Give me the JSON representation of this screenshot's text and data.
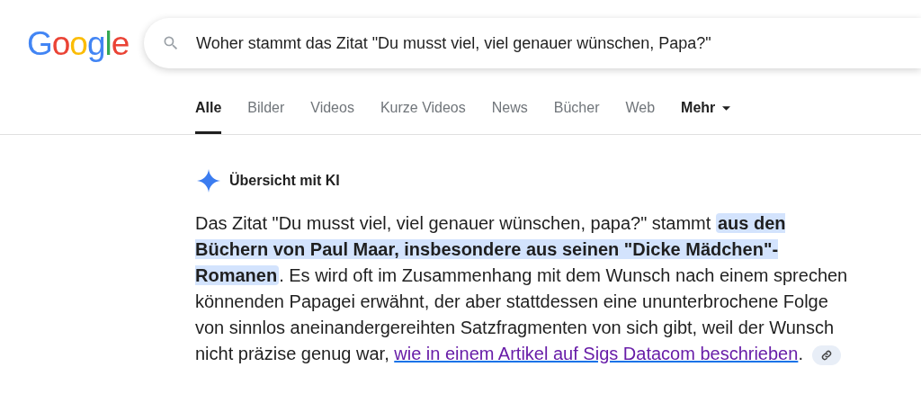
{
  "logo": "Google",
  "search": {
    "value": "Woher stammt das Zitat \"Du musst viel, viel genauer wünschen, Papa?\""
  },
  "tabs": [
    {
      "label": "Alle",
      "selected": true,
      "kind": "tab"
    },
    {
      "label": "Bilder",
      "selected": false,
      "kind": "tab"
    },
    {
      "label": "Videos",
      "selected": false,
      "kind": "tab"
    },
    {
      "label": "Kurze Videos",
      "selected": false,
      "kind": "tab"
    },
    {
      "label": "News",
      "selected": false,
      "kind": "tab"
    },
    {
      "label": "Bücher",
      "selected": false,
      "kind": "tab"
    },
    {
      "label": "Web",
      "selected": false,
      "kind": "tab"
    },
    {
      "label": "Mehr",
      "selected": false,
      "kind": "menu"
    }
  ],
  "ai_overview": {
    "title": "Übersicht mit KI",
    "paragraph": [
      {
        "kind": "text",
        "text": "Das Zitat \"Du musst viel, viel genauer wünschen, papa?\" stammt "
      },
      {
        "kind": "highlight",
        "text": "aus den Büchern von Paul Maar, insbesondere aus seinen \"Dicke Mädchen\"-Romanen"
      },
      {
        "kind": "text",
        "text": ". Es wird oft im Zusammenhang mit dem Wunsch nach einem sprechen könnenden Papagei erwähnt, der aber stattdessen eine ununterbrochene Folge von sinnlos aneinandergereihten Satzfragmenten von sich gibt, weil der Wunsch nicht präzise genug war, "
      },
      {
        "kind": "link",
        "text": "wie in einem Artikel auf Sigs Datacom beschrieben"
      },
      {
        "kind": "text",
        "text": "."
      }
    ]
  }
}
